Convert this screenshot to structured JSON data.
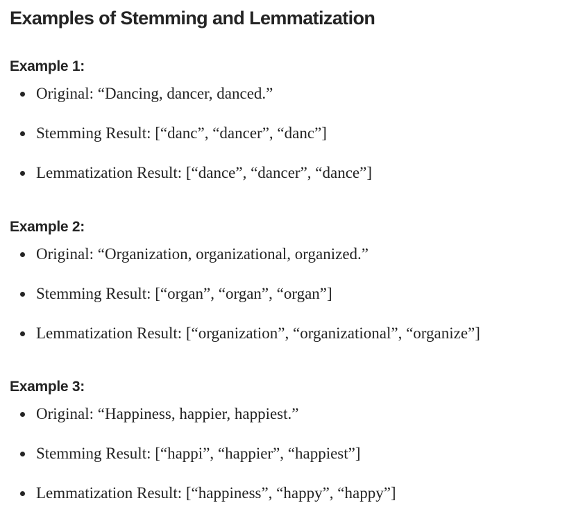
{
  "title": "Examples of Stemming and Lemmatization",
  "examples": [
    {
      "heading": "Example 1:",
      "items": [
        "Original: “Dancing, dancer, danced.”",
        "Stemming Result: [“danc”, “dancer”, “danc”]",
        "Lemmatization Result: [“dance”, “dancer”, “dance”]"
      ]
    },
    {
      "heading": "Example 2:",
      "items": [
        "Original: “Organization, organizational, organized.”",
        "Stemming Result: [“organ”, “organ”, “organ”]",
        "Lemmatization Result: [“organization”, “organizational”, “organize”]"
      ]
    },
    {
      "heading": "Example 3:",
      "items": [
        "Original: “Happiness, happier, happiest.”",
        "Stemming Result: [“happi”, “happier”, “happiest”]",
        "Lemmatization Result: [“happiness”, “happy”, “happy”]"
      ]
    }
  ]
}
